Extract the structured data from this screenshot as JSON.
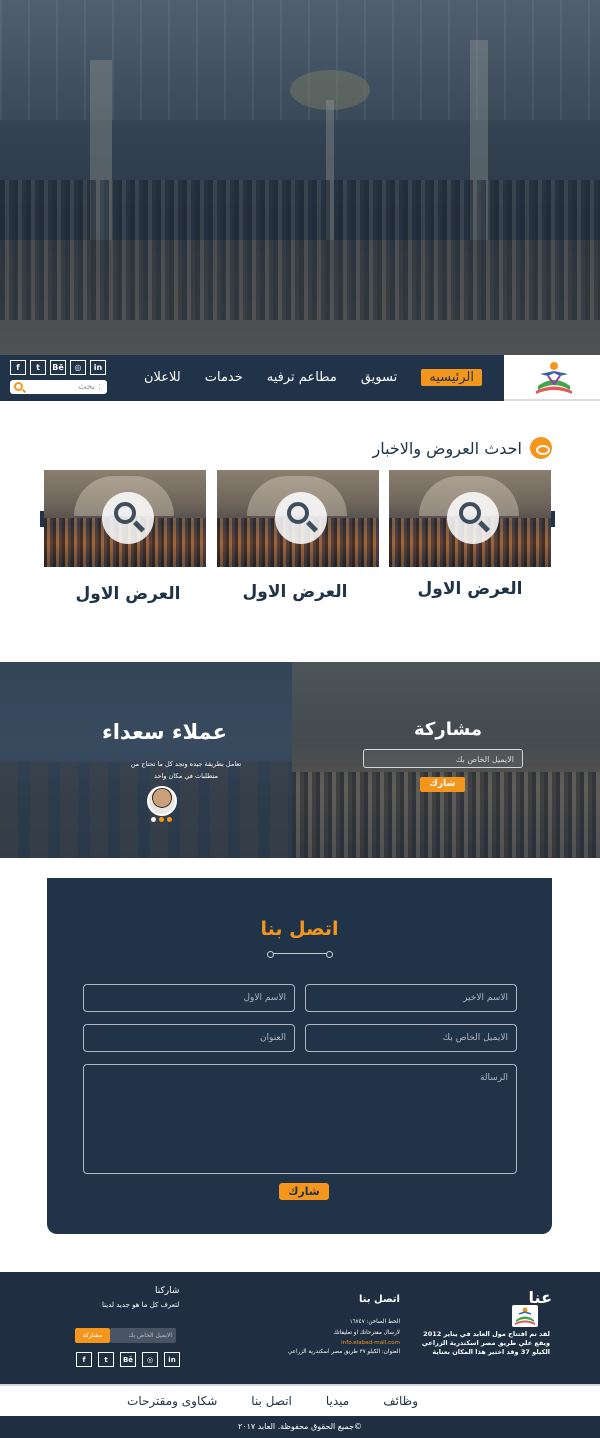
{
  "nav": {
    "items": [
      "الرئيسيه",
      "تسويق",
      "مطاعم ترفيه",
      "خدمات",
      "للاعلان"
    ],
    "search_placeholder": "بحث :",
    "social": [
      "f",
      "t",
      "Bē",
      "◎",
      "in"
    ]
  },
  "offers": {
    "title": "احدث العروض والاخبار",
    "cards": [
      {
        "title": "العرض الاول"
      },
      {
        "title": "العرض الاول"
      },
      {
        "title": "العرض الاول"
      }
    ]
  },
  "banner": {
    "happy_title": "عملاء سعداء",
    "happy_text": "تعامل بطريقة جيده وتجد كل ما تحتاج من متطلبات في مكان واحد",
    "share_title": "مشاركة",
    "share_placeholder": "الايميل الخاص بك",
    "share_button": "شارك"
  },
  "contact": {
    "title": "اتصل بنا",
    "last_name": "الاسم الاخير",
    "first_name": "الاسم الاول",
    "email": "الايميل الخاص بك",
    "address": "العنوان",
    "message": "الرسالة",
    "submit": "شارك"
  },
  "footer": {
    "about_title": "عنا",
    "about_text": "لقد تم افتتاح مول العابد في يناير 2012 ويقع علي طريق مصر اسكندرية الزراعي الكيلو 37 وقد اختير هذا المكان بعناية",
    "contact_title": "اتصل بنا",
    "hotline": "الخط الساخن: ١٦٧٤٧",
    "suggestions": "لارسال مقترحاتك او تعليقاتك",
    "email": "info.elabed-mall.com",
    "address": "العنوان: الكيلو ٣٧ طريق مصر اسكندرية الزراعي",
    "share_title": "شاركنا",
    "share_text": "لتعرف كل ما هو جديد لدينا",
    "share_placeholder": "الايميل الخاص بك",
    "share_button": "مشاركة",
    "social": [
      "f",
      "t",
      "Bē",
      "◎",
      "in"
    ]
  },
  "links": [
    "وظائف",
    "ميديا",
    "اتصل بنا",
    "شكاوى ومقترحات"
  ],
  "copyright": "جميع الحقوق محفوظة. العابد ٢٠١٧©",
  "colors": {
    "accent": "#f3961b",
    "navy": "#203348"
  }
}
